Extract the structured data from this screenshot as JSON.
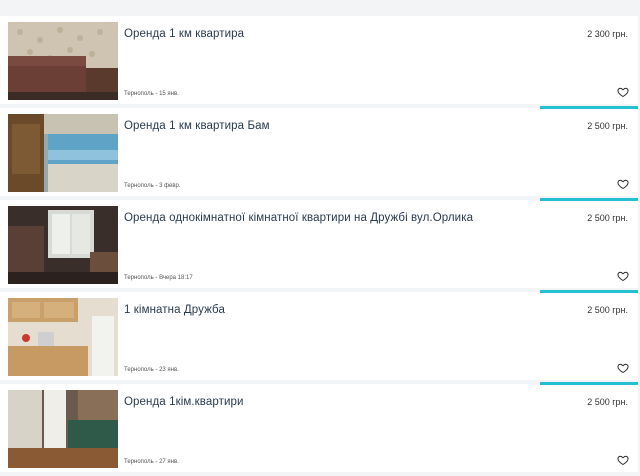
{
  "listings": [
    {
      "title": "Оренда 1 км квартира",
      "price": "2 300 грн.",
      "meta": "Тернополь - 15 янв.",
      "icon": "heart-icon"
    },
    {
      "title": "Оренда 1 км квартира Бам",
      "price": "2 500 грн.",
      "meta": "Тернополь - 3 февр.",
      "icon": "heart-icon"
    },
    {
      "title": "Оренда однокімнатної кімнатної квартири на Дружбі вул.Орлика",
      "price": "2 500 грн.",
      "meta": "Тернополь - Вчера 18:17",
      "icon": "heart-icon"
    },
    {
      "title": "1 кімнатна Дружба",
      "price": "2 500 грн.",
      "meta": "Тернополь - 23 янв.",
      "icon": "heart-icon"
    },
    {
      "title": "Оренда 1кім.квартири",
      "price": "2 500 грн.",
      "meta": "Тернополь - 27 янв.",
      "icon": "heart-icon"
    }
  ],
  "colors": {
    "accent": "#23c1cf",
    "title_text": "#2a3b4d",
    "card_bg": "#ffffff",
    "page_bg": "#f2f4f5"
  }
}
